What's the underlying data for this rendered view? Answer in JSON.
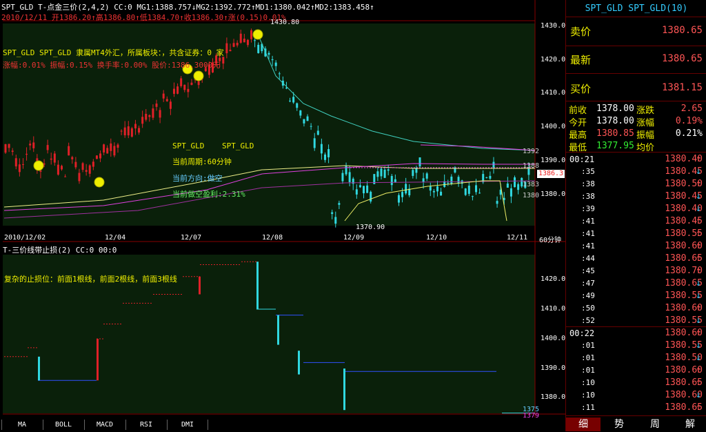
{
  "main_header": {
    "line1": "SPT_GLD T-点金三价(2,4,2) CC:0 MG1:1388.757↓MG2:1392.772↑MD1:1380.042↑MD2:1383.458↑",
    "line2": "2010/12/11 开1386.20↑高1386.80↑低1384.70↑收1386.30↑涨(0.15)0.01%"
  },
  "chart_info": {
    "line1": "SPT_GLD SPT_GLD 隶属MT4外汇，所属板块：，共含证券：0 家",
    "line2": "涨幅:0.01% 振幅:0.15% 换手率:0.00% 股价:1386.3000元",
    "code": "SPT_GLD",
    "name": "SPT_GLD",
    "period": "当前周期:60分钟",
    "direction": "当前方向:做空",
    "profit": "当前做空盈利:2.31%"
  },
  "sub_header": "T-三价线带止损(2) CC:0 00:0",
  "sub_note": "复杂的止损位：前面1根线，前面2根线，前面3根线",
  "main_axis": {
    "ticks": [
      "1430.0",
      "1420.0",
      "1410.0",
      "1400.0",
      "1390.0",
      "1380.0"
    ],
    "labels_right": [
      "1392",
      "1388",
      "1383",
      "1380"
    ],
    "current": "1386.3"
  },
  "sub_axis": {
    "ticks": [
      "1420.0",
      "1410.0",
      "1400.0",
      "1390.0",
      "1380.0"
    ],
    "bottom_labels": [
      "1379",
      "1375"
    ]
  },
  "annotations": {
    "high": "1430.80",
    "low": "1370.90"
  },
  "dates": [
    "2010/12/02",
    "12/04",
    "12/07",
    "12/08",
    "12/09",
    "12/10",
    "12/11"
  ],
  "period_label": "60分钟",
  "bottom_tabs": [
    "MA",
    "BOLL",
    "MACD",
    "RSI",
    "DMI"
  ],
  "right_panel": {
    "title": "SPT_GLD SPT_GLD(10)",
    "sell_label": "卖价",
    "sell_value": "1380.65",
    "last_label": "最新",
    "last_value": "1380.65",
    "buy_label": "买价",
    "buy_value": "1381.15",
    "stats": [
      {
        "l1": "前收",
        "v1": "1378.00",
        "l2": "涨跌",
        "v2": "2.65"
      },
      {
        "l1": "今开",
        "v1": "1378.00",
        "l2": "涨幅",
        "v2": "0.19%"
      },
      {
        "l1": "最高",
        "v1": "1380.85",
        "l2": "振幅",
        "v2": "0.21%"
      },
      {
        "l1": "最低",
        "v1": "1377.95",
        "l2": "均价",
        "v2": ""
      }
    ],
    "ticks": [
      {
        "t": "00:21",
        "p": "1380.40",
        "d": "up"
      },
      {
        "t": ":35",
        "p": "1380.45",
        "d": "down"
      },
      {
        "t": ":38",
        "p": "1380.50",
        "d": "up"
      },
      {
        "t": ":38",
        "p": "1380.45",
        "d": "down"
      },
      {
        "t": ":39",
        "p": "1380.40",
        "d": "down"
      },
      {
        "t": ":41",
        "p": "1380.45",
        "d": "up"
      },
      {
        "t": ":41",
        "p": "1380.55",
        "d": "up"
      },
      {
        "t": ":41",
        "p": "1380.60",
        "d": "up"
      },
      {
        "t": ":44",
        "p": "1380.65",
        "d": "up"
      },
      {
        "t": ":45",
        "p": "1380.70",
        "d": "up"
      },
      {
        "t": ":47",
        "p": "1380.65",
        "d": "down"
      },
      {
        "t": ":49",
        "p": "1380.55",
        "d": "down"
      },
      {
        "t": ":50",
        "p": "1380.60",
        "d": "up"
      },
      {
        "t": ":52",
        "p": "1380.55",
        "d": "down"
      },
      {
        "t": "00:22",
        "p": "1380.60",
        "d": "up"
      },
      {
        "t": ":01",
        "p": "1380.55",
        "d": "down"
      },
      {
        "t": ":01",
        "p": "1380.50",
        "d": "down"
      },
      {
        "t": ":01",
        "p": "1380.60",
        "d": "up"
      },
      {
        "t": ":10",
        "p": "1380.65",
        "d": "up"
      },
      {
        "t": ":10",
        "p": "1380.60",
        "d": "down"
      },
      {
        "t": ":11",
        "p": "1380.65",
        "d": "up"
      }
    ],
    "tabs": [
      "细",
      "势",
      "周",
      "解"
    ]
  },
  "colors": {
    "up": "#e0202a",
    "down": "#30e0e8",
    "bg": "#0a200a",
    "text_yellow": "#eeee00"
  }
}
